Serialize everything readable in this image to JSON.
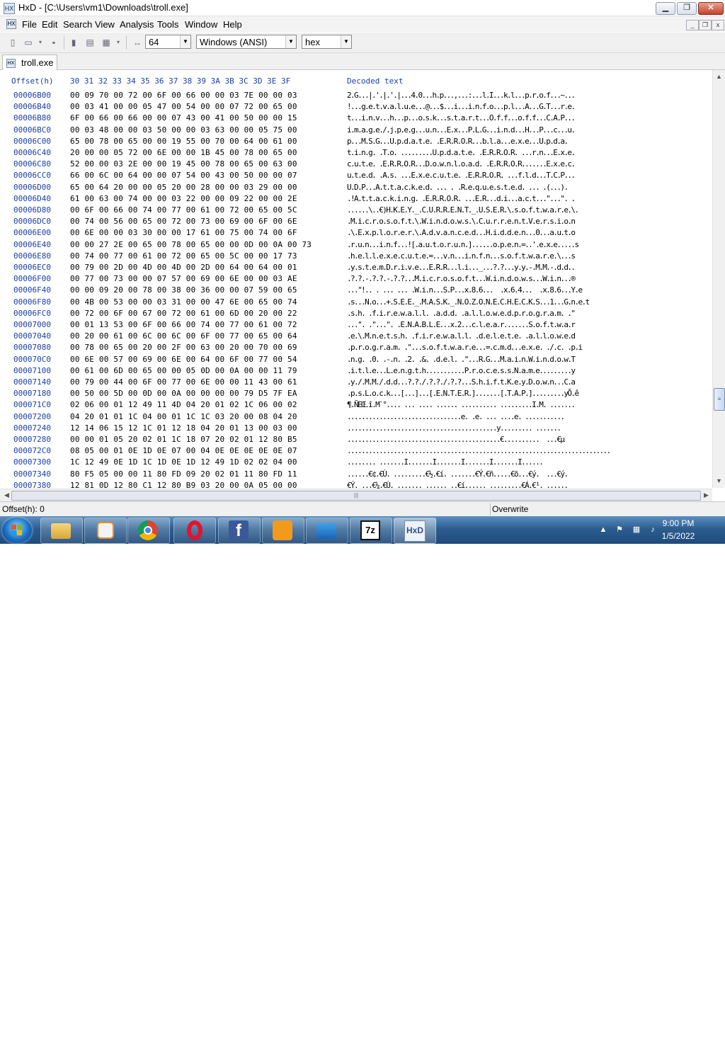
{
  "window": {
    "title": "HxD - [C:\\Users\\vm1\\Downloads\\troll.exe]",
    "controls": {
      "minimize": "▁",
      "maximize": "❐",
      "close": "✕"
    }
  },
  "menu": [
    "File",
    "Edit",
    "Search",
    "View",
    "Analysis",
    "Tools",
    "Window",
    "Help"
  ],
  "toolbar": {
    "bytes_per_row": "64",
    "charset": "Windows (ANSI)",
    "offset_base": "hex"
  },
  "tab": {
    "label": "troll.exe"
  },
  "editor": {
    "offset_header": "Offset(h)",
    "hex_header": "30 31 32 33 34 35 36 37 38 39 3A 3B 3C 3D 3E 3F",
    "text_header": "Decoded text",
    "rows": [
      {
        "offset": "00006B00",
        "hex": "00 09 70 00 72 00 6F 00 66 00 00 03 7E 00 00 03",
        "text": "2.G...|.'.|.'.|...4.0...h.p...,...:...l.I...k.l...p.r.o.f...~..."
      },
      {
        "offset": "00006B40",
        "hex": "00 03 41 00 00 05 47 00 54 00 00 07 72 00 65 00",
        "text": "!...g.e.t.v.a.l.u.e...@...$...i...i.n.f.o...p.l...A...G.T...r.e."
      },
      {
        "offset": "00006B80",
        "hex": "6F 00 66 00 66 00 00 07 43 00 41 00 50 00 00 15",
        "text": "t...i.n.v...h...p...o.s.k...s.t.a.r.t...O.f.f...o.f.f...C.A.P..."
      },
      {
        "offset": "00006BC0",
        "hex": "00 03 48 00 00 03 50 00 00 03 63 00 00 05 75 00",
        "text": "i.m.a.g.e./.j.p.e.g...u.n...E.x...P.L.G...i.n.d...H...P...c...u."
      },
      {
        "offset": "00006C00",
        "hex": "65 00 78 00 65 00 00 19 55 00 70 00 64 00 61 00",
        "text": "p...M.S.G...U.p.d.a.t.e. .E.R.R.O.R...b.l.a...e.x.e...U.p.d.a."
      },
      {
        "offset": "00006C40",
        "hex": "20 00 00 05 72 00 6E 00 00 1B 45 00 78 00 65 00",
        "text": "t.i.n.g. .T.o. .........U.p.d.a.t.e. .E.R.R.O.R. ...r.n...E.x.e."
      },
      {
        "offset": "00006C80",
        "hex": "52 00 00 03 2E 00 00 19 45 00 78 00 65 00 63 00",
        "text": "c.u.t.e. .E.R.R.O.R...D.o.w.n.l.o.a.d. .E.R.R.O.R.......E.x.e.c."
      },
      {
        "offset": "00006CC0",
        "hex": "66 00 6C 00 64 00 00 07 54 00 43 00 50 00 00 07",
        "text": "u.t.e.d. .A.s. ...E.x.e.c.u.t.e. .E.R.R.O.R. ...f.l.d...T.C.P..."
      },
      {
        "offset": "00006D00",
        "hex": "65 00 64 20 00 00 05 20 00 28 00 00 03 29 00 00",
        "text": "U.D.P...A.t.t.a.c.k.e.d. ... . .R.e.q.u.e.s.t.e.d. ... .(...)."
      },
      {
        "offset": "00006D40",
        "hex": "61 00 63 00 74 00 00 03 22 00 00 09 22 00 00 2E",
        "text": ".!A.t.t.a.c.k.i.n.g. .E.R.R.O.R. ...E.R...d.i...a.c.t...\"...\". ."
      },
      {
        "offset": "00006D80",
        "hex": "00 6F 00 66 00 74 00 77 00 61 00 72 00 65 00 5C",
        "text": "......\\..€)H.K.E.Y._.C.U.R.R.E.N.T._.U.S.E.R.\\.s.o.f.t.w.a.r.e.\\."
      },
      {
        "offset": "00006DC0",
        "hex": "00 74 00 56 00 65 00 72 00 73 00 69 00 6F 00 6E",
        "text": ".M.i.c.r.o.s.o.f.t.\\.W.i.n.d.o.w.s.\\.C.u.r.r.e.n.t.V.e.r.s.i.o.n"
      },
      {
        "offset": "00006E00",
        "hex": "00 6E 00 00 03 30 00 00 17 61 00 75 00 74 00 6F",
        "text": ".\\.E.x.p.l.o.r.e.r.\\.A.d.v.a.n.c.e.d...H.i.d.d.e.n...0...a.u.t.o"
      },
      {
        "offset": "00006E40",
        "hex": "00 00 27 2E 00 65 00 78 00 65 00 00 0D 00 0A 00 73",
        "text": ".r.u.n...i.n.f...![.a.u.t.o.r.u.n.]......o.p.e.n.=..'.e.x.e.....s"
      },
      {
        "offset": "00006E80",
        "hex": "00 74 00 77 00 61 00 72 00 65 00 5C 00 00 17 73",
        "text": ".h.e.l.l.e.x.e.c.u.t.e.=...v.n...i.n.f.n...s.o.f.t.w.a.r.e.\\...s"
      },
      {
        "offset": "00006EC0",
        "hex": "00 79 00 2D 00 4D 00 4D 00 2D 00 64 00 64 00 01",
        "text": ".y.s.t.e.m.D.r.i.v.e...E.R.R...l.i..._...?.?...y.y.-.M.M.-.d.d.."
      },
      {
        "offset": "00006F00",
        "hex": "00 77 00 73 00 00 07 57 00 69 00 6E 00 00 03 AE",
        "text": ".?.?.-.?.?.-.?.?...M.i.c.r.o.s.o.f.t...W.i.n.d.o.w.s...W.i.n...®"
      },
      {
        "offset": "00006F40",
        "hex": "00 00 09 20 00 78 00 38 00 36 00 00 07 59 00 65",
        "text": "...\"!.. . ... ... .W.i.n...S.P...x.8.6...  .x.6.4...  .x.8.6...Y.e"
      },
      {
        "offset": "00006F80",
        "hex": "00 4B 00 53 00 00 03 31 00 00 47 6E 00 65 00 74",
        "text": ".s...N.o...+.S.E.E._.M.A.S.K._.N.O.Z.O.N.E.C.H.E.C.K.S...1...G.n.e.t"
      },
      {
        "offset": "00006FC0",
        "hex": "00 72 00 6F 00 67 00 72 00 61 00 6D 00 20 00 22",
        "text": ".s.h. .f.i.r.e.w.a.l.l. .a.d.d. .a.l.l.o.w.e.d.p.r.o.g.r.a.m. .\""
      },
      {
        "offset": "00007000",
        "hex": "00 01 13 53 00 6F 00 66 00 74 00 77 00 61 00 72",
        "text": "...\". .\"...\". .E.N.A.B.L.E...x.2...c.l.e.a.r.......S.o.f.t.w.a.r"
      },
      {
        "offset": "00007040",
        "hex": "00 20 00 61 00 6C 00 6C 00 6F 00 77 00 65 00 64",
        "text": ".e.\\.M.n.e.t.s.h. .f.i.r.e.w.a.l.l. .d.e.l.e.t.e. .a.l.l.o.w.e.d"
      },
      {
        "offset": "00007080",
        "hex": "00 78 00 65 00 20 00 2F 00 63 00 20 00 70 00 69",
        "text": ".p.r.o.g.r.a.m. .\"...s.o.f.t.w.a.r.e...=.c.m.d...e.x.e. ./.c. .p.i"
      },
      {
        "offset": "000070C0",
        "hex": "00 6E 00 57 00 69 00 6E 00 64 00 6F 00 77 00 54",
        "text": ".n.g. .0. .-.n. .2. .&. .d.e.l. .\"...R.G...M.a.i.n.W.i.n.d.o.w.T"
      },
      {
        "offset": "00007100",
        "hex": "00 61 00 6D 00 65 00 00 05 0D 00 0A 00 00 11 79",
        "text": ".i.t.l.e...L.e.n.g.t.h...........P.r.o.c.e.s.s.N.a.m.e.........y"
      },
      {
        "offset": "00007140",
        "hex": "00 79 00 44 00 6F 00 77 00 6E 00 00 11 43 00 61",
        "text": ".y./.M.M./.d.d...?.?./.?.?./.?.?...S.h.i.f.t.K.e.y.D.o.w.n...C.a"
      },
      {
        "offset": "00007180",
        "hex": "00 50 00 5D 00 0D 00 0A 00 00 00 00 79 D5 7F EA",
        "text": ".p.s.L.o.c.k...[...]...[.E.N.T.E.R.].......[.T.A.P.].........yÕ.ê"
      },
      {
        "offset": "000071C0",
        "hex": "02 06 00 01 12 49 11 4D 04 20 01 02 1C 06 00 02",
        "text": "¶.ÑEŒ.î.M`°.... ... .... ...... .......... .........I.M. ......."
      },
      {
        "offset": "00007200",
        "hex": "04 20 01 01 1C 04 00 01 1C 1C 03 20 00 08 04 20",
        "text": "................................e. .e. ... ....e. ..........."
      },
      {
        "offset": "00007240",
        "hex": "12 14 06 15 12 1C 01 12 18 04 20 01 13 00 03 00",
        "text": "..........................................y......... ......."
      },
      {
        "offset": "00007280",
        "hex": "00 00 01 05 20 02 01 1C 18 07 20 02 01 12 80 B5",
        "text": "...........................................€..........  ...€µ"
      },
      {
        "offset": "000072C0",
        "hex": "08 05 00 01 0E 1D 0E 07 00 04 0E 0E 0E 0E 0E 07",
        "text": ".........................................................................."
      },
      {
        "offset": "00007300",
        "hex": "1C 12 49 0E 1D 1C 1D 0E 1D 12 49 1D 02 02 04 00",
        "text": "........ .......I.......I.......I.......I.......I......"
      },
      {
        "offset": "00007340",
        "hex": "80 F5 05 00 00 11 80 FD 09 20 02 01 11 80 FD 11",
        "text": "......€¢.€Ù. .........€½.€í. .......€Ý.€ñ.....€õ...€ý.  ...€ý."
      },
      {
        "offset": "00007380",
        "hex": "12 81 0D 12 80 C1 12 80 B9 03 20 00 0A 05 00 00",
        "text": "€Ý. ...€¼.€Ù. ....... ...... ..€í...... .........€Á.€¹. ......"
      }
    ]
  },
  "status": {
    "offset": "Offset(h): 0",
    "mode": "Overwrite"
  },
  "taskbar": {
    "apps": [
      "file-explorer",
      "media-player",
      "chrome",
      "opera",
      "facebook",
      "search-tool",
      "windows-app",
      "7-zip",
      "hxd"
    ],
    "time": "9:00 PM",
    "date": "1/5/2022"
  }
}
